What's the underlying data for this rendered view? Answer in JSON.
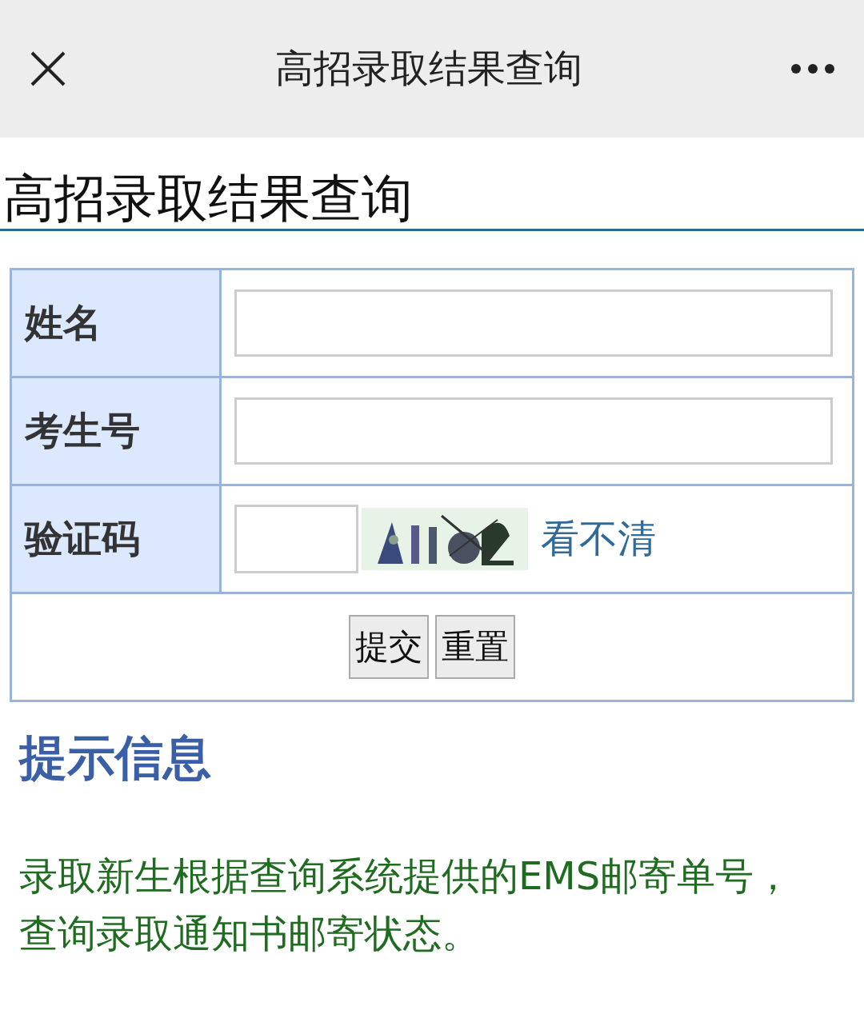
{
  "top_bar": {
    "title": "高招录取结果查询"
  },
  "heading": "高招录取结果查询",
  "form": {
    "rows": [
      {
        "kind": "text",
        "label": "姓名"
      },
      {
        "kind": "text",
        "label": "考生号"
      },
      {
        "kind": "captcha",
        "label": "验证码",
        "refresh_link": "看不清"
      }
    ],
    "buttons": [
      "提交",
      "重置"
    ]
  },
  "notice": {
    "title": "提示信息",
    "text": "录取新生根据查询系统提供的EMS邮寄单号，查询录取通知书邮寄状态。"
  }
}
